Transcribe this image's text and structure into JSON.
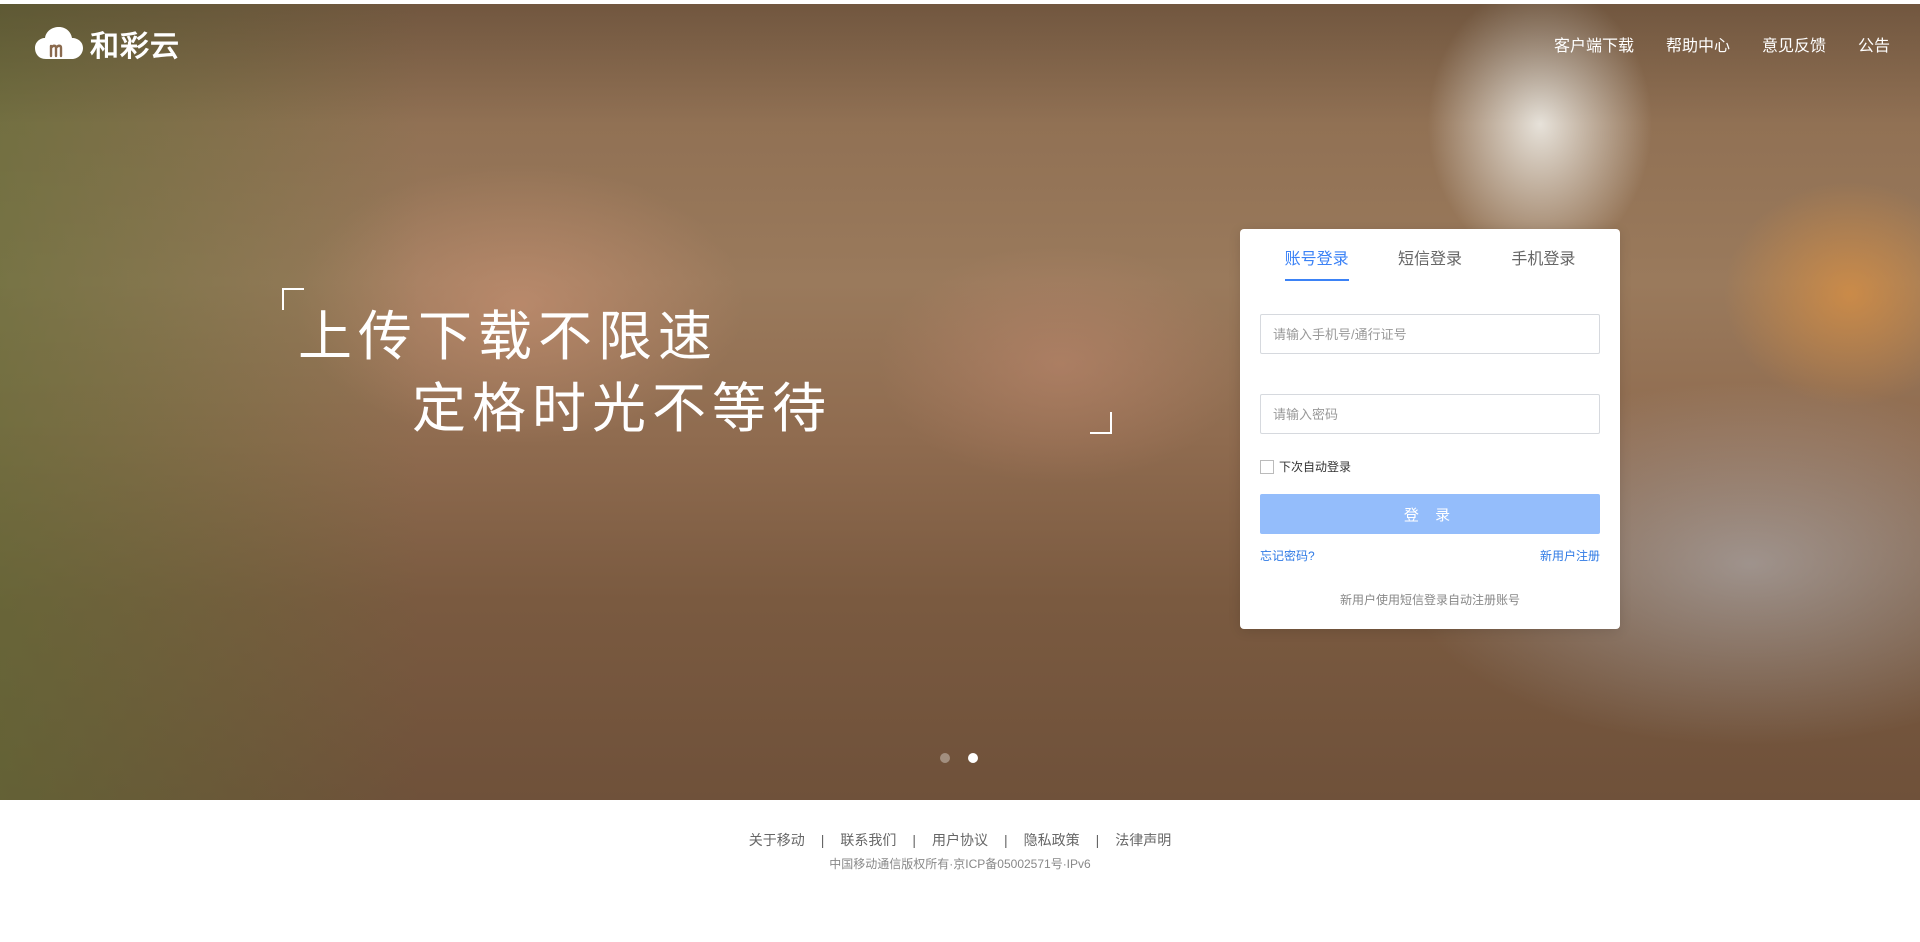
{
  "header": {
    "logo_text": "和彩云",
    "nav": [
      "客户端下载",
      "帮助中心",
      "意见反馈",
      "公告"
    ]
  },
  "hero": {
    "slogan_line1": "上传下载不限速",
    "slogan_line2": "定格时光不等待",
    "carousel": {
      "total": 2,
      "active": 2
    }
  },
  "login": {
    "tabs": [
      {
        "label": "账号登录",
        "active": true
      },
      {
        "label": "短信登录",
        "active": false
      },
      {
        "label": "手机登录",
        "active": false
      }
    ],
    "account_placeholder": "请输入手机号/通行证号",
    "account_value": "",
    "password_placeholder": "请输入密码",
    "password_value": "",
    "remember_label": "下次自动登录",
    "remember_checked": false,
    "submit_label": "登 录",
    "forgot_label": "忘记密码?",
    "register_label": "新用户注册",
    "hint": "新用户使用短信登录自动注册账号"
  },
  "footer": {
    "links": [
      "关于移动",
      "联系我们",
      "用户协议",
      "隐私政策",
      "法律声明"
    ],
    "copyright": "中国移动通信版权所有·京ICP备05002571号·IPv6"
  },
  "colors": {
    "accent": "#3b82f6",
    "button_disabled": "#94bdfb",
    "link": "#2f7ae5"
  }
}
